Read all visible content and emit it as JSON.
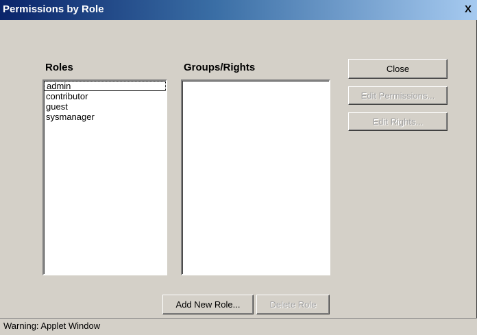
{
  "window": {
    "title": "Permissions by Role",
    "close_label": "X"
  },
  "roles": {
    "label": "Roles",
    "items": [
      "admin",
      "contributor",
      "guest",
      "sysmanager"
    ]
  },
  "groups_rights": {
    "label": "Groups/Rights",
    "items": []
  },
  "buttons": {
    "close": "Close",
    "edit_permissions": "Edit Permissions...",
    "edit_rights": "Edit Rights...",
    "add_new_role": "Add New Role...",
    "delete_role": "Delete Role"
  },
  "status": {
    "text": "Warning: Applet Window"
  }
}
